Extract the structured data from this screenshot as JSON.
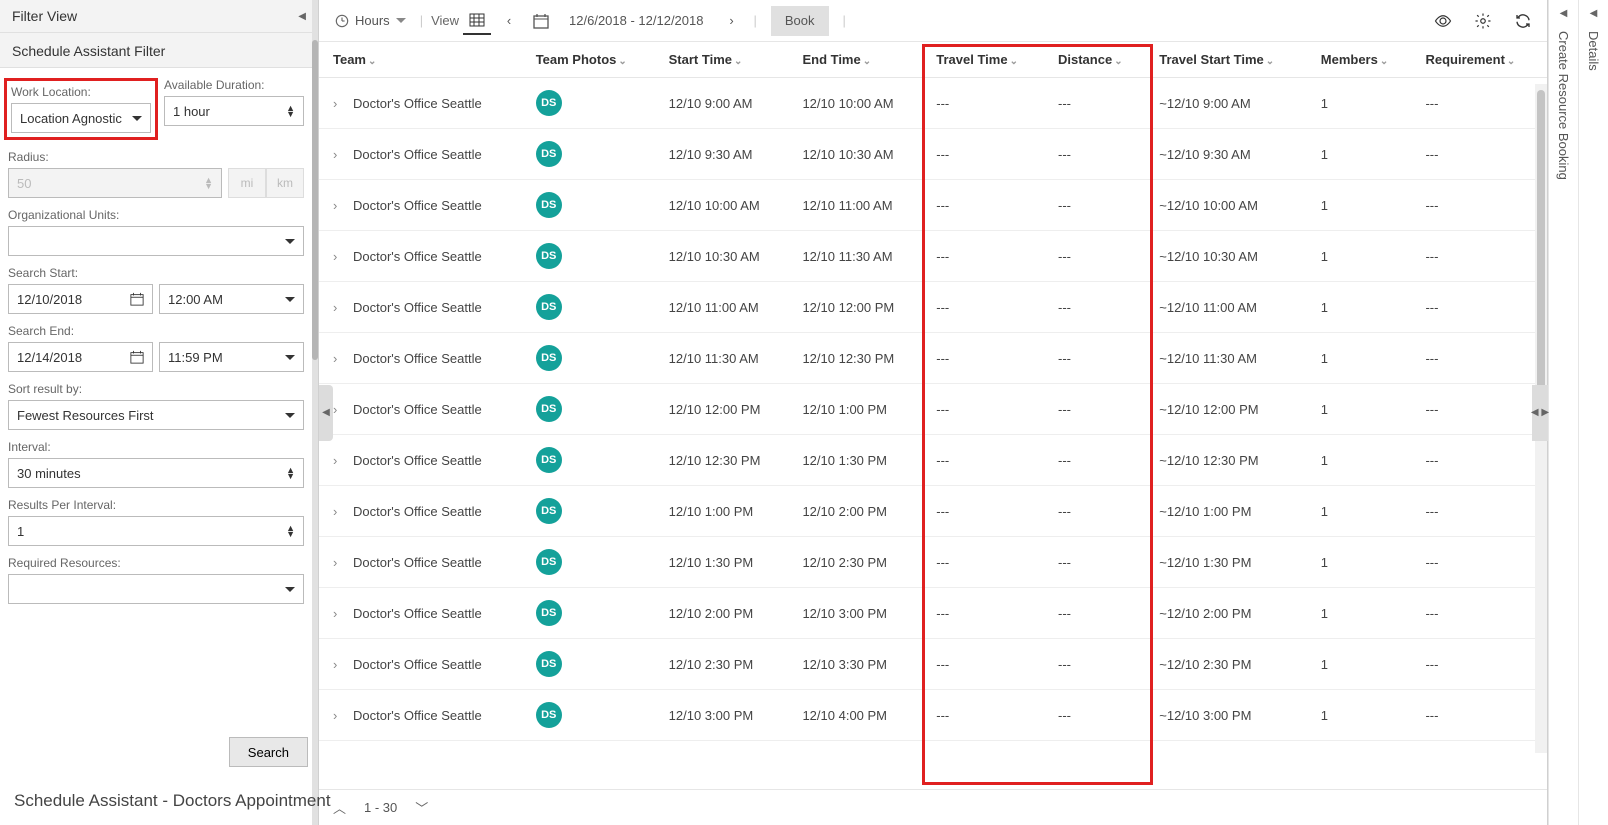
{
  "sidebar": {
    "filter_view_title": "Filter View",
    "schedule_assistant_filter": "Schedule Assistant Filter",
    "work_location_label": "Work Location:",
    "work_location_value": "Location Agnostic",
    "available_duration_label": "Available Duration:",
    "available_duration_value": "1 hour",
    "radius_label": "Radius:",
    "radius_value": "50",
    "unit_mi": "mi",
    "unit_km": "km",
    "org_units_label": "Organizational Units:",
    "org_units_value": "",
    "search_start_label": "Search Start:",
    "search_start_date": "12/10/2018",
    "search_start_time": "12:00 AM",
    "search_end_label": "Search End:",
    "search_end_date": "12/14/2018",
    "search_end_time": "11:59 PM",
    "sort_result_label": "Sort result by:",
    "sort_result_value": "Fewest Resources First",
    "interval_label": "Interval:",
    "interval_value": "30 minutes",
    "results_per_interval_label": "Results Per Interval:",
    "results_per_interval_value": "1",
    "required_resources_label": "Required Resources:",
    "required_resources_value": "",
    "search_button": "Search"
  },
  "toolbar": {
    "hours_label": "Hours",
    "view_label": "View",
    "date_range": "12/6/2018 - 12/12/2018",
    "book_button": "Book"
  },
  "grid_headers": {
    "team": "Team",
    "team_photos": "Team Photos",
    "start_time": "Start Time",
    "end_time": "End Time",
    "travel_time": "Travel Time",
    "distance": "Distance",
    "travel_start_time": "Travel Start Time",
    "members": "Members",
    "requirement": "Requirement"
  },
  "rows": [
    {
      "team": "Doctor's Office Seattle",
      "avatar": "DS",
      "start": "12/10 9:00 AM",
      "end": "12/10 10:00 AM",
      "travel": "---",
      "dist": "---",
      "tstart": "~12/10 9:00 AM",
      "members": "1",
      "req": "---"
    },
    {
      "team": "Doctor's Office Seattle",
      "avatar": "DS",
      "start": "12/10 9:30 AM",
      "end": "12/10 10:30 AM",
      "travel": "---",
      "dist": "---",
      "tstart": "~12/10 9:30 AM",
      "members": "1",
      "req": "---"
    },
    {
      "team": "Doctor's Office Seattle",
      "avatar": "DS",
      "start": "12/10 10:00 AM",
      "end": "12/10 11:00 AM",
      "travel": "---",
      "dist": "---",
      "tstart": "~12/10 10:00 AM",
      "members": "1",
      "req": "---"
    },
    {
      "team": "Doctor's Office Seattle",
      "avatar": "DS",
      "start": "12/10 10:30 AM",
      "end": "12/10 11:30 AM",
      "travel": "---",
      "dist": "---",
      "tstart": "~12/10 10:30 AM",
      "members": "1",
      "req": "---"
    },
    {
      "team": "Doctor's Office Seattle",
      "avatar": "DS",
      "start": "12/10 11:00 AM",
      "end": "12/10 12:00 PM",
      "travel": "---",
      "dist": "---",
      "tstart": "~12/10 11:00 AM",
      "members": "1",
      "req": "---"
    },
    {
      "team": "Doctor's Office Seattle",
      "avatar": "DS",
      "start": "12/10 11:30 AM",
      "end": "12/10 12:30 PM",
      "travel": "---",
      "dist": "---",
      "tstart": "~12/10 11:30 AM",
      "members": "1",
      "req": "---"
    },
    {
      "team": "Doctor's Office Seattle",
      "avatar": "DS",
      "start": "12/10 12:00 PM",
      "end": "12/10 1:00 PM",
      "travel": "---",
      "dist": "---",
      "tstart": "~12/10 12:00 PM",
      "members": "1",
      "req": "---"
    },
    {
      "team": "Doctor's Office Seattle",
      "avatar": "DS",
      "start": "12/10 12:30 PM",
      "end": "12/10 1:30 PM",
      "travel": "---",
      "dist": "---",
      "tstart": "~12/10 12:30 PM",
      "members": "1",
      "req": "---"
    },
    {
      "team": "Doctor's Office Seattle",
      "avatar": "DS",
      "start": "12/10 1:00 PM",
      "end": "12/10 2:00 PM",
      "travel": "---",
      "dist": "---",
      "tstart": "~12/10 1:00 PM",
      "members": "1",
      "req": "---"
    },
    {
      "team": "Doctor's Office Seattle",
      "avatar": "DS",
      "start": "12/10 1:30 PM",
      "end": "12/10 2:30 PM",
      "travel": "---",
      "dist": "---",
      "tstart": "~12/10 1:30 PM",
      "members": "1",
      "req": "---"
    },
    {
      "team": "Doctor's Office Seattle",
      "avatar": "DS",
      "start": "12/10 2:00 PM",
      "end": "12/10 3:00 PM",
      "travel": "---",
      "dist": "---",
      "tstart": "~12/10 2:00 PM",
      "members": "1",
      "req": "---"
    },
    {
      "team": "Doctor's Office Seattle",
      "avatar": "DS",
      "start": "12/10 2:30 PM",
      "end": "12/10 3:30 PM",
      "travel": "---",
      "dist": "---",
      "tstart": "~12/10 2:30 PM",
      "members": "1",
      "req": "---"
    },
    {
      "team": "Doctor's Office Seattle",
      "avatar": "DS",
      "start": "12/10 3:00 PM",
      "end": "12/10 4:00 PM",
      "travel": "---",
      "dist": "---",
      "tstart": "~12/10 3:00 PM",
      "members": "1",
      "req": "---"
    }
  ],
  "pager": {
    "range": "1 - 30"
  },
  "footer": {
    "label": "Schedule Assistant - Doctors Appointment"
  },
  "rails": {
    "create_resource_booking": "Create Resource Booking",
    "details": "Details"
  }
}
